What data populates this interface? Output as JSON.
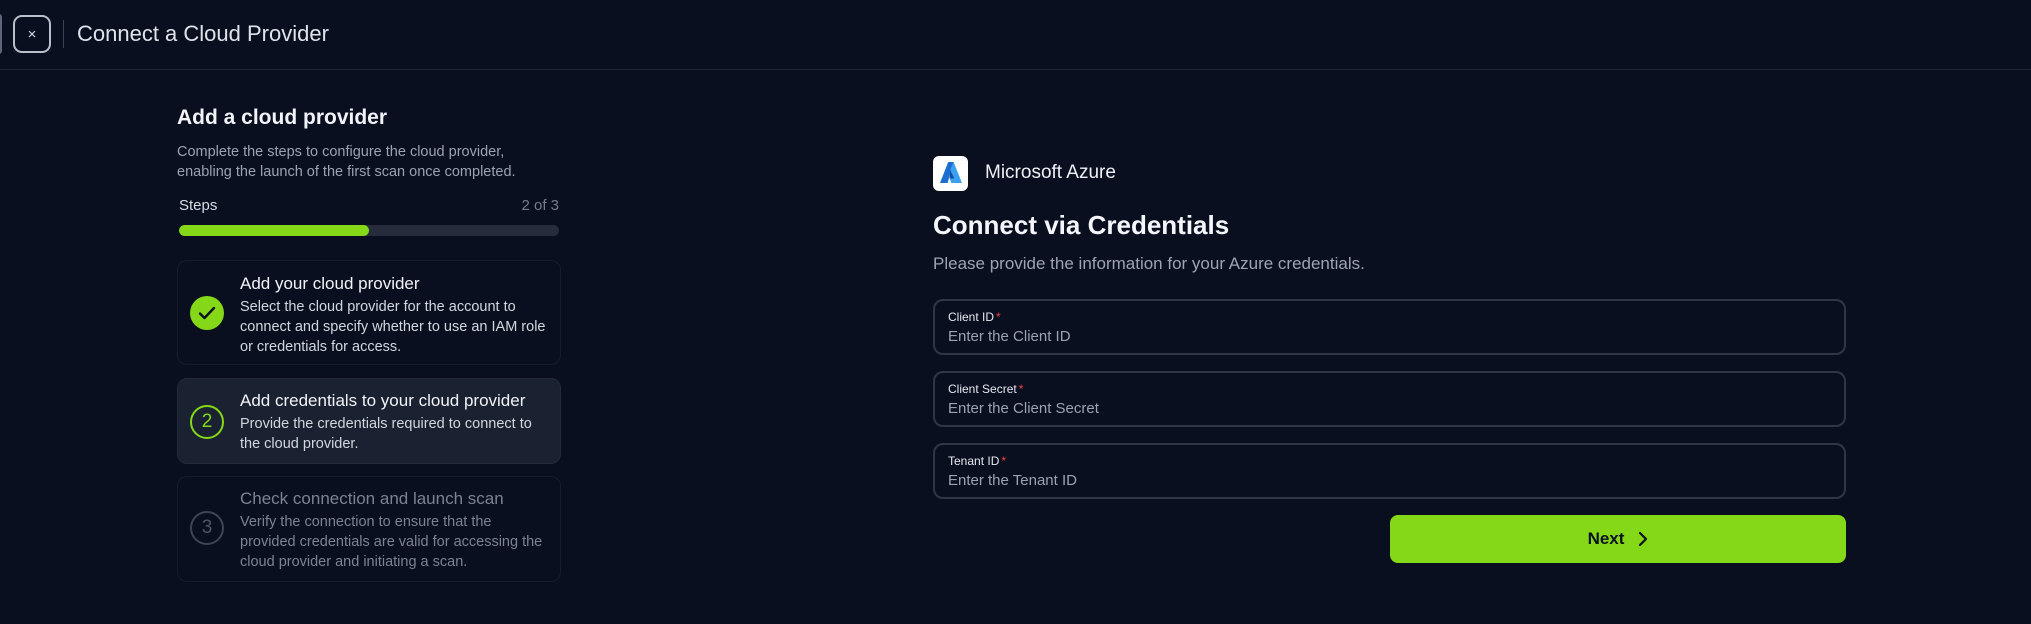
{
  "header": {
    "close_symbol": "×",
    "title": "Connect a Cloud Provider"
  },
  "sidebar": {
    "title": "Add a cloud provider",
    "description_line1": "Complete the steps to configure the cloud provider,",
    "description_line2": "enabling the launch of the first scan once completed.",
    "steps_label": "Steps",
    "steps_count": "2 of 3",
    "progress_fraction": 0.5,
    "steps": [
      {
        "status": "done",
        "marker": "",
        "title": "Add your cloud provider",
        "description": "Select the cloud provider for the account to connect and specify whether to use an IAM role or credentials for access."
      },
      {
        "status": "current",
        "marker": "2",
        "title": "Add credentials to your cloud provider",
        "description": "Provide the credentials required to connect to the cloud provider."
      },
      {
        "status": "pending",
        "marker": "3",
        "title": "Check connection and launch scan",
        "description": "Verify the connection to ensure that the provided credentials are valid for accessing the cloud provider and initiating a scan."
      }
    ]
  },
  "main": {
    "provider_name": "Microsoft Azure",
    "provider_icon": "azure-logo",
    "heading": "Connect via Credentials",
    "description": "Please provide the information for your Azure credentials.",
    "fields": [
      {
        "label": "Client ID",
        "required_mark": "*",
        "placeholder": "Enter the Client ID",
        "value": ""
      },
      {
        "label": "Client Secret",
        "required_mark": "*",
        "placeholder": "Enter the Client Secret",
        "value": ""
      },
      {
        "label": "Tenant ID",
        "required_mark": "*",
        "placeholder": "Enter the Tenant ID",
        "value": ""
      }
    ],
    "next_label": "Next"
  },
  "colors": {
    "background": "#0a0f1f",
    "accent": "#84d817",
    "required": "#ef4444"
  }
}
